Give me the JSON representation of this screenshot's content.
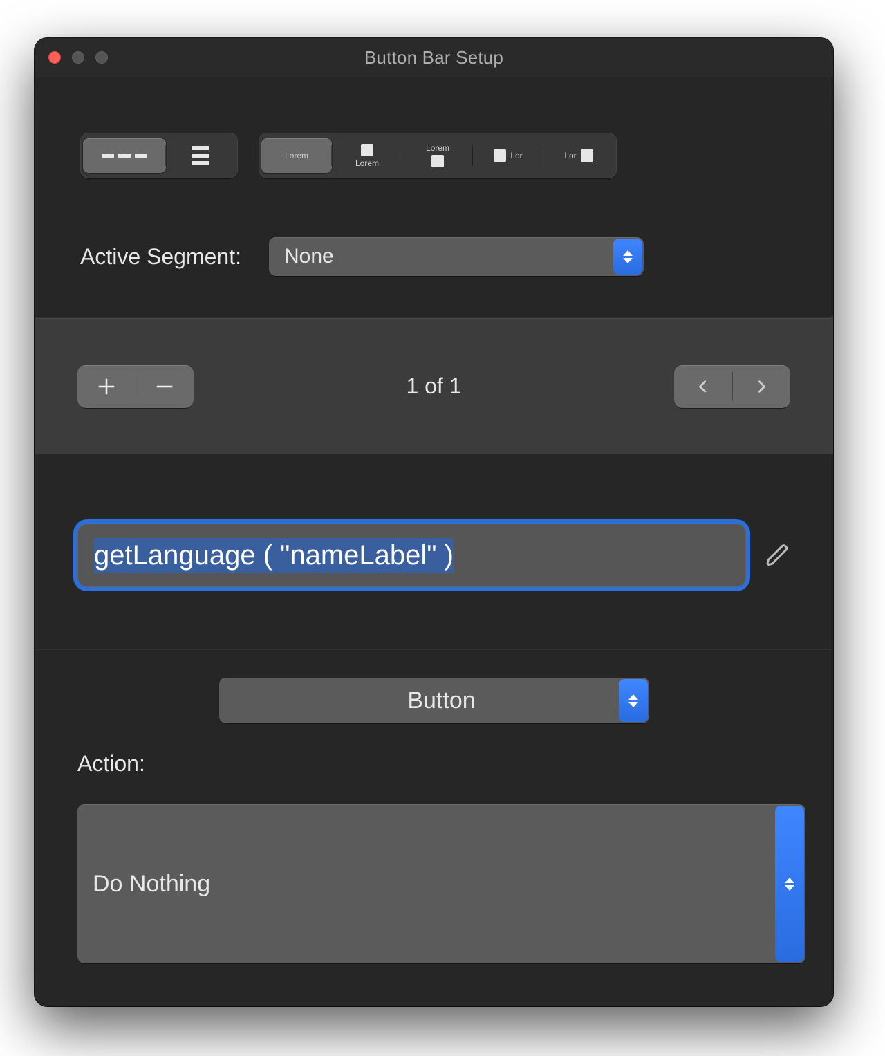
{
  "window": {
    "title": "Button Bar Setup"
  },
  "styleSegmentsA": {
    "selectedIndex": 0,
    "items": [
      "horizontal",
      "vertical"
    ]
  },
  "styleSegmentsB": {
    "selectedIndex": 0,
    "items": [
      {
        "layout": "label-only",
        "text": "Lorem"
      },
      {
        "layout": "icon-above-label",
        "text": "Lorem"
      },
      {
        "layout": "label-above-icon",
        "text": "Lorem"
      },
      {
        "layout": "icon-then-label",
        "text": "Lor"
      },
      {
        "layout": "label-then-icon",
        "text": "Lor"
      }
    ]
  },
  "activeSegment": {
    "label": "Active Segment:",
    "value": "None"
  },
  "segmentNav": {
    "counter": "1 of 1"
  },
  "labelField": {
    "value": "getLanguage ( \"nameLabel\" )"
  },
  "typePopup": {
    "value": "Button"
  },
  "action": {
    "label": "Action:",
    "value": "Do Nothing"
  }
}
